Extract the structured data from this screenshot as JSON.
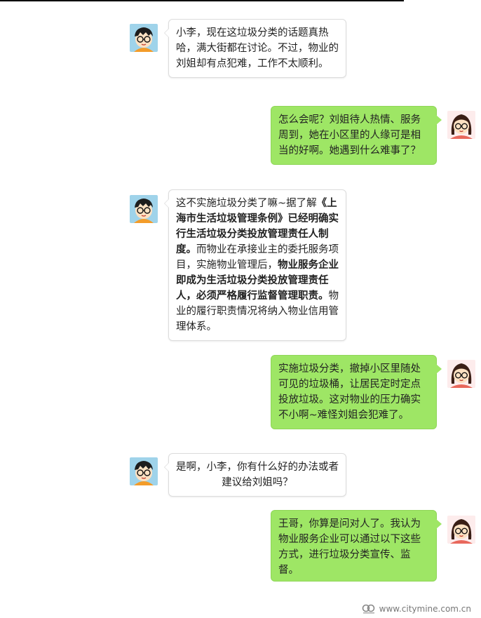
{
  "messages": [
    {
      "side": "left",
      "avatar": "boy-glasses-avatar",
      "parts": [
        {
          "text": "小李，现在这垃圾分类的话题真热哈，满大街都在讨论。不过，物业的刘姐却有点犯难，工作不太顺利。",
          "bold": false
        }
      ]
    },
    {
      "side": "right",
      "avatar": "girl-glasses-avatar",
      "parts": [
        {
          "text": "怎么会呢？刘姐待人热情、服务周到，她在小区里的人缘可是相当的好啊。她遇到什么难事了？",
          "bold": false
        }
      ]
    },
    {
      "side": "left",
      "avatar": "boy-glasses-avatar",
      "parts": [
        {
          "text": "这不实施垃圾分类了嘛~据了解",
          "bold": false
        },
        {
          "text": "《上海市生活垃圾管理条例》已经明确实行生活垃圾分类投放管理责任人制度。",
          "bold": true
        },
        {
          "text": "而物业在承接业主的委托服务项目，实施物业管理后，",
          "bold": false
        },
        {
          "text": "物业服务企业即成为生活垃圾分类投放管理责任人，必须严格履行监督管理职责。",
          "bold": true
        },
        {
          "text": "物业的履行职责情况将纳入物业信用管理体系。",
          "bold": false
        }
      ]
    },
    {
      "side": "right",
      "avatar": "girl-glasses-avatar",
      "parts": [
        {
          "text": "实施垃圾分类，撤掉小区里随处可见的垃圾桶，让居民定时定点投放垃圾。这对物业的压力确实不小啊~难怪刘姐会犯难了。",
          "bold": false
        }
      ]
    },
    {
      "side": "left",
      "avatar": "boy-glasses-avatar",
      "parts": [
        {
          "text": "是啊，小李，你有什么好的办法或者建议给刘姐吗？",
          "bold": false
        }
      ]
    },
    {
      "side": "right",
      "avatar": "girl-glasses-avatar",
      "parts": [
        {
          "text": "王哥，你算是问对人了。我认为物业服务企业可以通过以下这些方式，进行垃圾分类宣传、监督。",
          "bold": false
        }
      ]
    }
  ],
  "watermark": {
    "text": "www.citymine.com.cn",
    "icon": "citymine-logo-icon"
  },
  "colors": {
    "right_bubble": "#9ee665",
    "left_bubble": "#ffffff",
    "border": "#dcdcdc"
  }
}
